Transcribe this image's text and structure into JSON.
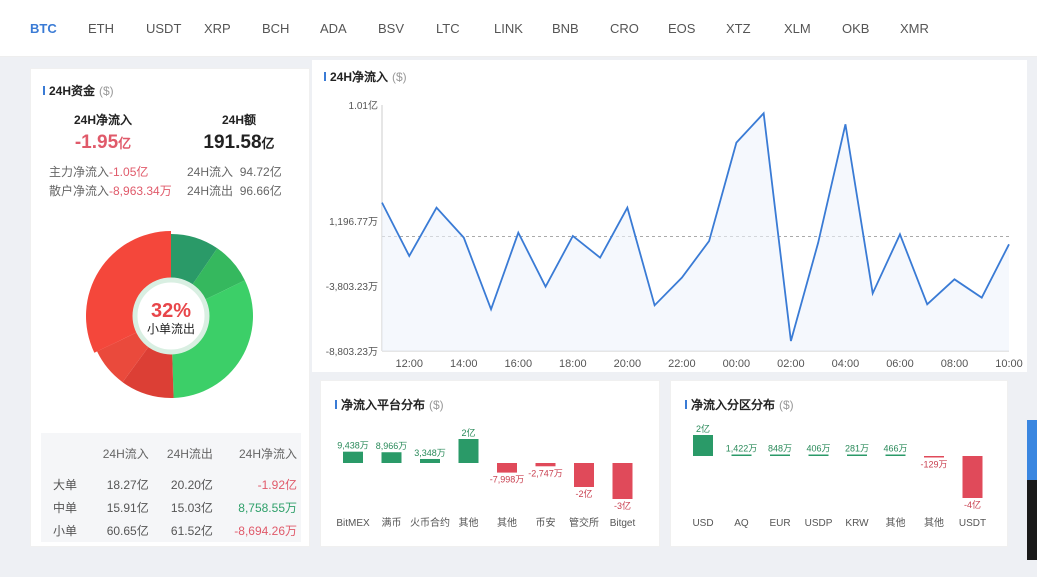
{
  "tabs": [
    "BTC",
    "ETH",
    "USDT",
    "XRP",
    "BCH",
    "ADA",
    "BSV",
    "LTC",
    "LINK",
    "BNB",
    "CRO",
    "EOS",
    "XTZ",
    "XLM",
    "OKB",
    "XMR"
  ],
  "active_tab": "BTC",
  "left": {
    "title": "24H资金",
    "unit": "($)",
    "net_label": "24H净流入",
    "net_value": "-1.95",
    "net_unit": "亿",
    "vol_label": "24H额",
    "vol_value": "191.58",
    "vol_unit": "亿",
    "main_label": "主力净流入",
    "main_value": "-1.05亿",
    "retail_label": "散户净流入",
    "retail_value": "-8,963.34万",
    "in_label": "24H流入",
    "in_value": "94.72亿",
    "out_label": "24H流出",
    "out_value": "96.66亿",
    "donut": {
      "percent": "32%",
      "label": "小单流出",
      "segments": [
        {
          "name": "大单流入",
          "value": 18.27,
          "color": "#2a9a68"
        },
        {
          "name": "中单流入",
          "value": 15.91,
          "color": "#35b85e"
        },
        {
          "name": "小单流入",
          "value": 60.65,
          "color": "#3ccf68"
        },
        {
          "name": "大单流出",
          "value": 20.2,
          "color": "#dc3f35"
        },
        {
          "name": "中单流出",
          "value": 15.03,
          "color": "#ea4a3c"
        },
        {
          "name": "小单流出",
          "value": 61.52,
          "color": "#f4473b"
        }
      ]
    },
    "table": {
      "headers": [
        "",
        "24H流入",
        "24H流出",
        "24H净流入"
      ],
      "rows": [
        [
          "大单",
          "18.27亿",
          "20.20亿",
          "-1.92亿"
        ],
        [
          "中单",
          "15.91亿",
          "15.03亿",
          "8,758.55万"
        ],
        [
          "小单",
          "60.65亿",
          "61.52亿",
          "-8,694.26万"
        ]
      ]
    }
  },
  "chart_data": [
    {
      "type": "line",
      "title": "24H净流入",
      "unit": "($)",
      "x": [
        "11:00",
        "12:00",
        "13:00",
        "14:00",
        "15:00",
        "16:00",
        "17:00",
        "18:00",
        "19:00",
        "20:00",
        "21:00",
        "22:00",
        "23:00",
        "00:00",
        "01:00",
        "02:00",
        "03:00",
        "04:00",
        "05:00",
        "06:00",
        "07:00",
        "08:00",
        "09:00",
        "10:00"
      ],
      "values_wan": [
        2607,
        -1495,
        2222,
        -85,
        -5598,
        300,
        -3854,
        43,
        -1624,
        2222,
        -5290,
        -3162,
        -342,
        7222,
        9479,
        -8034,
        -470,
        8632,
        -4367,
        171,
        -5214,
        -3290,
        -4700,
        -598
      ],
      "ylim_wan": [
        -8803.23,
        10116.77
      ],
      "yticks": [
        {
          "v": 10116.77,
          "label": "1.01亿"
        },
        {
          "v": 1196.77,
          "label": "1,196.77万"
        },
        {
          "v": -3803.23,
          "label": "-3,803.23万"
        },
        {
          "v": -8803.23,
          "label": "-8,803.23万"
        }
      ],
      "xticks": [
        "12:00",
        "14:00",
        "16:00",
        "18:00",
        "20:00",
        "22:00",
        "00:00",
        "02:00",
        "04:00",
        "06:00",
        "08:00",
        "10:00"
      ],
      "reference_line": 0,
      "color": "#3a7bd5"
    },
    {
      "type": "bar",
      "title": "净流入平台分布",
      "unit": "($)",
      "categories": [
        "BitMEX",
        "满币",
        "火币合约",
        "其他",
        "其他",
        "币安",
        "管交所",
        "Bitget"
      ],
      "values_wan": [
        9438,
        8966,
        3348,
        20000,
        -7998,
        -2747,
        -20000,
        -30000
      ],
      "labels": [
        "9,438万",
        "8,966万",
        "3,348万",
        "2亿",
        "-7,998万",
        "-2,747万",
        "-2亿",
        "-3亿"
      ]
    },
    {
      "type": "bar",
      "title": "净流入分区分布",
      "unit": "($)",
      "categories": [
        "USD",
        "AQ",
        "EUR",
        "USDP",
        "KRW",
        "其他",
        "其他",
        "USDT"
      ],
      "values_wan": [
        20000,
        1422,
        848,
        406,
        281,
        466,
        -129,
        -40000
      ],
      "labels": [
        "2亿",
        "1,422万",
        "848万",
        "406万",
        "281万",
        "466万",
        "-129万",
        "-4亿"
      ]
    }
  ],
  "colors": {
    "accent": "#3a7bd5",
    "up": "#2a9a68",
    "down": "#e04a5a"
  }
}
